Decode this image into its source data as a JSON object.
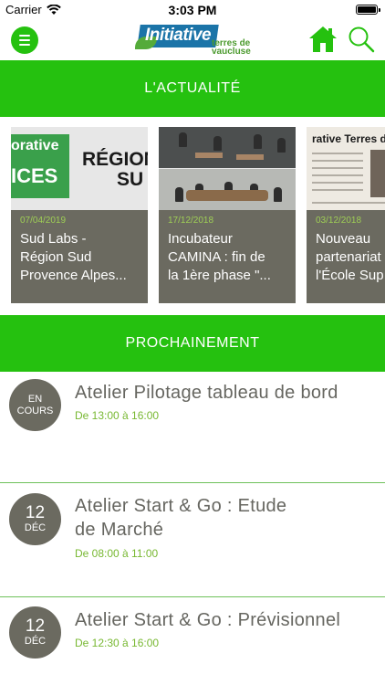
{
  "status_bar": {
    "carrier": "Carrier",
    "time": "3:03 PM"
  },
  "header": {
    "logo_text": "Initiative",
    "logo_sub_line1": "terres de",
    "logo_sub_line2": "vaucluse",
    "icons": {
      "menu": "hamburger-icon",
      "home": "home-icon",
      "search": "search-icon"
    }
  },
  "sections": {
    "news_title": "L'ACTUALITÉ",
    "upcoming_title": "PROCHAINEMENT"
  },
  "news": [
    {
      "date": "07/04/2019",
      "title": "Sud Labs  -\nRégion Sud\nProvence Alpes...",
      "image_text": {
        "t1": "orative",
        "t2": "ICES",
        "t3": "RÉGION",
        "t4": "SU"
      }
    },
    {
      "date": "17/12/2018",
      "title": "Incubateur\nCAMINA : fin de\nla 1ère phase \"..."
    },
    {
      "date": "03/12/2018",
      "title": "Nouveau\npartenariat\nl'École Sup",
      "image_text": {
        "head": "rative Terres de Vaucluse"
      }
    }
  ],
  "events": [
    {
      "badge_line1": "EN",
      "badge_line2": "COURS",
      "title": "Atelier Pilotage tableau de bord",
      "time": "De 13:00 à 16:00"
    },
    {
      "badge_day": "12",
      "badge_month": "DÉC",
      "title": "Atelier Start & Go : Etude\nde Marché",
      "time": "De 08:00 à 11:00"
    },
    {
      "badge_day": "12",
      "badge_month": "DÉC",
      "title": "Atelier Start & Go : Prévisionnel",
      "time": "De 12:30 à 16:00"
    }
  ],
  "colors": {
    "brand_green": "#25c10f",
    "card_grey": "#6b6a60",
    "date_green": "#9fcf55",
    "time_green": "#78b832",
    "logo_blue": "#1b74a8"
  }
}
